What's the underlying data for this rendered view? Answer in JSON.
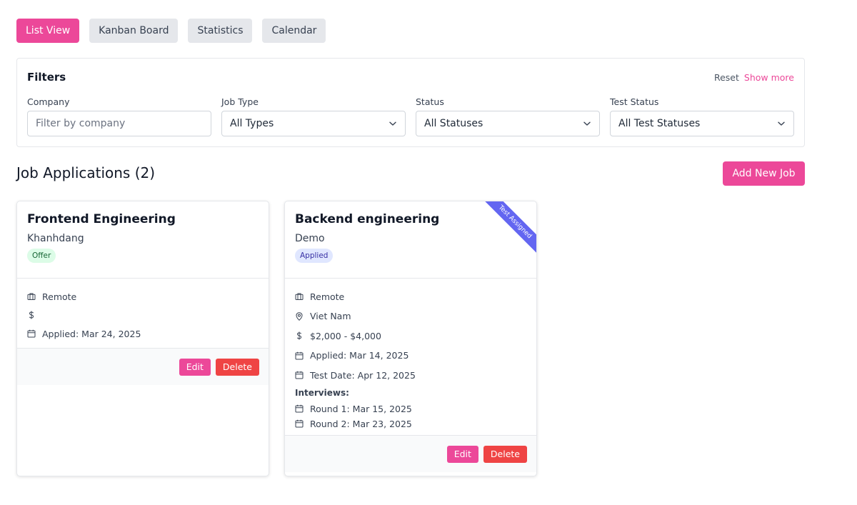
{
  "view_tabs": [
    "List View",
    "Kanban Board",
    "Statistics",
    "Calendar"
  ],
  "filters": {
    "title": "Filters",
    "reset": "Reset",
    "show_more": "Show more",
    "company_label": "Company",
    "company_placeholder": "Filter by company",
    "company_value": "",
    "job_type_label": "Job Type",
    "job_type_value": "All Types",
    "status_label": "Status",
    "status_value": "All Statuses",
    "test_status_label": "Test Status",
    "test_status_value": "All Test Statuses"
  },
  "heading": "Job Applications (2)",
  "add_button": "Add New Job",
  "jobs": [
    {
      "title": "Frontend Engineering",
      "company": "Khanhdang",
      "status": "Offer",
      "work_mode": "Remote",
      "salary": "",
      "applied": "Applied: Mar 24, 2025",
      "edit": "Edit",
      "delete": "Delete"
    },
    {
      "title": "Backend engineering",
      "company": "Demo",
      "status": "Applied",
      "ribbon": "Test Assigned",
      "work_mode": "Remote",
      "location": "Viet Nam",
      "salary": "$2,000 - $4,000",
      "applied": "Applied: Mar 14, 2025",
      "test_date": "Test Date: Apr 12, 2025",
      "interviews_label": "Interviews:",
      "interviews": [
        "Round 1: Mar 15, 2025",
        "Round 2: Mar 23, 2025"
      ],
      "edit": "Edit",
      "delete": "Delete"
    }
  ],
  "colors": {
    "accent": "#ec4899",
    "danger": "#ef4444",
    "ribbon": "#6366f1",
    "offer_badge_bg": "#dcfce7",
    "applied_badge_bg": "#e0e7ff"
  },
  "icons": {
    "work_mode": "briefcase-icon",
    "location": "map-pin-icon",
    "salary": "dollar-icon",
    "date": "calendar-icon",
    "dropdown": "chevron-down-icon"
  }
}
